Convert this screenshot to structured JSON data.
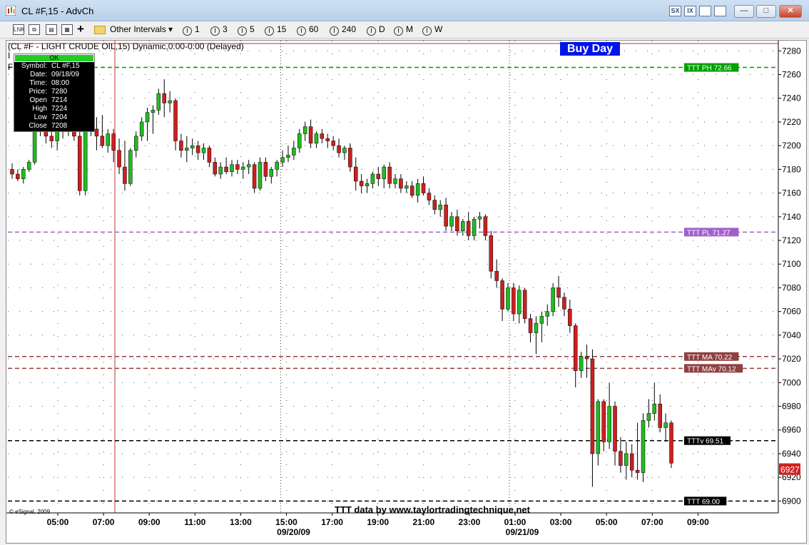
{
  "window": {
    "title": "CL #F,15 - AdvCh",
    "title_buttons": [
      "SX",
      "IX"
    ],
    "controls": {
      "minimize": "—",
      "maximize": "□",
      "close": "✕"
    }
  },
  "toolbar": {
    "icons": [
      "link-icon",
      "copy-icon",
      "paste-icon",
      "properties-icon",
      "add-icon",
      "folder-icon"
    ],
    "add_symbol": "+",
    "other_intervals": "Other Intervals ▾",
    "intervals": [
      "1",
      "3",
      "5",
      "15",
      "60",
      "240",
      "D",
      "M",
      "W"
    ],
    "interval_marker": "I"
  },
  "chart_header": "(CL #F - LIGHT CRUDE OIL,15) Dynamic,0:00-0:00 (Delayed)",
  "side_letters": [
    "I",
    "F"
  ],
  "buy_day": "Buy Day",
  "info_box": {
    "ok_label": "OK",
    "rows": [
      {
        "key": "Symbol:",
        "value": "CL #F,15"
      },
      {
        "key": "Date:",
        "value": "09/18/09"
      },
      {
        "key": "Time:",
        "value": "08:00"
      },
      {
        "key": "Price:",
        "value": "7280"
      },
      {
        "key": "Open",
        "value": "7214"
      },
      {
        "key": "High",
        "value": "7224"
      },
      {
        "key": "Low",
        "value": "7204"
      },
      {
        "key": "Close",
        "value": "7208"
      }
    ]
  },
  "watermark": "TTT data by www.taylortradingtechnique.net",
  "copyright": "© eSignal, 2009",
  "colors": {
    "up": "#22bb22",
    "down": "#cc2020",
    "grid": "#555555",
    "ph": "#00a000",
    "pl": "#a060c8",
    "ma": "#904040",
    "black": "#000000"
  },
  "chart_data": {
    "type": "candlestick",
    "symbol": "CL #F,15",
    "y_range": [
      6890,
      7285
    ],
    "y_ticks": [
      7280,
      7260,
      7240,
      7220,
      7200,
      7180,
      7160,
      7140,
      7120,
      7100,
      7080,
      7060,
      7040,
      7020,
      7000,
      6980,
      6960,
      6940,
      6920,
      6900
    ],
    "x_ticks": [
      "05:00",
      "07:00",
      "09:00",
      "11:00",
      "13:00",
      "15:00",
      "17:00",
      "19:00",
      "21:00",
      "23:00",
      "01:00",
      "03:00",
      "05:00",
      "07:00",
      "09:00"
    ],
    "date_labels": [
      {
        "label": "09/20/09",
        "tick_index": 5
      },
      {
        "label": "09/21/09",
        "tick_index": 10
      }
    ],
    "last_price": "6927",
    "levels": [
      {
        "label": "TTT PH 72.66",
        "value": 7266,
        "style": "ph"
      },
      {
        "label": "TTT PL 71.27",
        "value": 7127,
        "style": "pl"
      },
      {
        "label": "TTT MA 70.22",
        "value": 7022,
        "style": "ma"
      },
      {
        "label": "TTT MAv 70.12",
        "value": 7012,
        "style": "ma"
      },
      {
        "label": "TTTv 69.51",
        "value": 6951,
        "style": "black"
      },
      {
        "label": "TTT 69.00",
        "value": 6900,
        "style": "black"
      }
    ],
    "ohlc": [
      [
        7180,
        7185,
        7172,
        7176
      ],
      [
        7176,
        7180,
        7170,
        7172
      ],
      [
        7172,
        7182,
        7168,
        7180
      ],
      [
        7180,
        7188,
        7178,
        7186
      ],
      [
        7186,
        7220,
        7184,
        7216
      ],
      [
        7216,
        7222,
        7208,
        7212
      ],
      [
        7212,
        7218,
        7202,
        7208
      ],
      [
        7208,
        7216,
        7198,
        7204
      ],
      [
        7204,
        7218,
        7196,
        7212
      ],
      [
        7212,
        7222,
        7206,
        7218
      ],
      [
        7218,
        7228,
        7208,
        7212
      ],
      [
        7212,
        7224,
        7204,
        7208
      ],
      [
        7208,
        7212,
        7158,
        7162
      ],
      [
        7162,
        7222,
        7158,
        7218
      ],
      [
        7218,
        7242,
        7208,
        7214
      ],
      [
        7214,
        7224,
        7196,
        7208
      ],
      [
        7208,
        7226,
        7198,
        7200
      ],
      [
        7200,
        7214,
        7194,
        7210
      ],
      [
        7210,
        7214,
        7186,
        7196
      ],
      [
        7196,
        7206,
        7176,
        7182
      ],
      [
        7182,
        7204,
        7162,
        7168
      ],
      [
        7168,
        7198,
        7166,
        7196
      ],
      [
        7196,
        7212,
        7190,
        7208
      ],
      [
        7208,
        7224,
        7204,
        7220
      ],
      [
        7220,
        7232,
        7204,
        7228
      ],
      [
        7228,
        7234,
        7210,
        7230
      ],
      [
        7230,
        7248,
        7226,
        7244
      ],
      [
        7244,
        7256,
        7224,
        7236
      ],
      [
        7236,
        7246,
        7228,
        7238
      ],
      [
        7238,
        7240,
        7196,
        7204
      ],
      [
        7204,
        7210,
        7190,
        7196
      ],
      [
        7196,
        7208,
        7186,
        7198
      ],
      [
        7198,
        7206,
        7192,
        7200
      ],
      [
        7200,
        7204,
        7188,
        7194
      ],
      [
        7194,
        7202,
        7188,
        7198
      ],
      [
        7198,
        7200,
        7182,
        7186
      ],
      [
        7186,
        7190,
        7174,
        7176
      ],
      [
        7176,
        7186,
        7172,
        7182
      ],
      [
        7182,
        7190,
        7176,
        7178
      ],
      [
        7178,
        7188,
        7174,
        7184
      ],
      [
        7184,
        7188,
        7176,
        7180
      ],
      [
        7180,
        7186,
        7172,
        7182
      ],
      [
        7182,
        7188,
        7176,
        7184
      ],
      [
        7184,
        7186,
        7160,
        7164
      ],
      [
        7164,
        7190,
        7162,
        7186
      ],
      [
        7186,
        7190,
        7170,
        7174
      ],
      [
        7174,
        7182,
        7168,
        7180
      ],
      [
        7180,
        7188,
        7174,
        7186
      ],
      [
        7186,
        7196,
        7182,
        7190
      ],
      [
        7190,
        7200,
        7186,
        7192
      ],
      [
        7192,
        7204,
        7188,
        7198
      ],
      [
        7198,
        7214,
        7194,
        7210
      ],
      [
        7210,
        7220,
        7204,
        7216
      ],
      [
        7216,
        7222,
        7198,
        7202
      ],
      [
        7202,
        7212,
        7198,
        7210
      ],
      [
        7210,
        7214,
        7202,
        7206
      ],
      [
        7206,
        7210,
        7198,
        7204
      ],
      [
        7204,
        7208,
        7196,
        7200
      ],
      [
        7200,
        7206,
        7190,
        7194
      ],
      [
        7194,
        7200,
        7188,
        7198
      ],
      [
        7198,
        7202,
        7178,
        7182
      ],
      [
        7182,
        7190,
        7162,
        7170
      ],
      [
        7170,
        7176,
        7160,
        7166
      ],
      [
        7166,
        7172,
        7160,
        7168
      ],
      [
        7168,
        7178,
        7164,
        7176
      ],
      [
        7176,
        7182,
        7166,
        7172
      ],
      [
        7172,
        7184,
        7164,
        7182
      ],
      [
        7182,
        7186,
        7164,
        7168
      ],
      [
        7168,
        7176,
        7164,
        7172
      ],
      [
        7172,
        7176,
        7160,
        7164
      ],
      [
        7164,
        7170,
        7160,
        7166
      ],
      [
        7166,
        7170,
        7156,
        7158
      ],
      [
        7158,
        7172,
        7152,
        7168
      ],
      [
        7168,
        7174,
        7158,
        7160
      ],
      [
        7160,
        7164,
        7150,
        7154
      ],
      [
        7154,
        7158,
        7142,
        7146
      ],
      [
        7146,
        7154,
        7140,
        7150
      ],
      [
        7150,
        7156,
        7128,
        7132
      ],
      [
        7132,
        7144,
        7128,
        7140
      ],
      [
        7140,
        7146,
        7124,
        7128
      ],
      [
        7128,
        7138,
        7124,
        7136
      ],
      [
        7136,
        7144,
        7120,
        7124
      ],
      [
        7124,
        7140,
        7120,
        7138
      ],
      [
        7138,
        7144,
        7130,
        7140
      ],
      [
        7140,
        7142,
        7120,
        7124
      ],
      [
        7124,
        7128,
        7088,
        7094
      ],
      [
        7094,
        7104,
        7080,
        7086
      ],
      [
        7086,
        7088,
        7052,
        7062
      ],
      [
        7062,
        7084,
        7060,
        7080
      ],
      [
        7080,
        7084,
        7052,
        7058
      ],
      [
        7058,
        7082,
        7050,
        7078
      ],
      [
        7078,
        7080,
        7050,
        7054
      ],
      [
        7054,
        7058,
        7034,
        7042
      ],
      [
        7042,
        7056,
        7024,
        7050
      ],
      [
        7050,
        7060,
        7034,
        7056
      ],
      [
        7056,
        7066,
        7048,
        7060
      ],
      [
        7060,
        7084,
        7056,
        7080
      ],
      [
        7080,
        7090,
        7064,
        7072
      ],
      [
        7072,
        7076,
        7056,
        7062
      ],
      [
        7062,
        7070,
        7042,
        7048
      ],
      [
        7048,
        7050,
        6996,
        7010
      ],
      [
        7010,
        7026,
        7004,
        7022
      ],
      [
        7022,
        7032,
        7004,
        7020
      ],
      [
        7020,
        7028,
        6912,
        6940
      ],
      [
        6940,
        6986,
        6930,
        6984
      ],
      [
        6984,
        6986,
        6942,
        6950
      ],
      [
        6950,
        7000,
        6944,
        6980
      ],
      [
        6980,
        6984,
        6930,
        6942
      ],
      [
        6942,
        6954,
        6924,
        6930
      ],
      [
        6930,
        6950,
        6918,
        6940
      ],
      [
        6940,
        6948,
        6920,
        6926
      ],
      [
        6926,
        6966,
        6918,
        6924
      ],
      [
        6924,
        6974,
        6916,
        6968
      ],
      [
        6968,
        6986,
        6962,
        6974
      ],
      [
        6974,
        7000,
        6968,
        6982
      ],
      [
        6982,
        6990,
        6958,
        6962
      ],
      [
        6962,
        6974,
        6950,
        6966
      ],
      [
        6966,
        6968,
        6928,
        6932
      ]
    ]
  }
}
